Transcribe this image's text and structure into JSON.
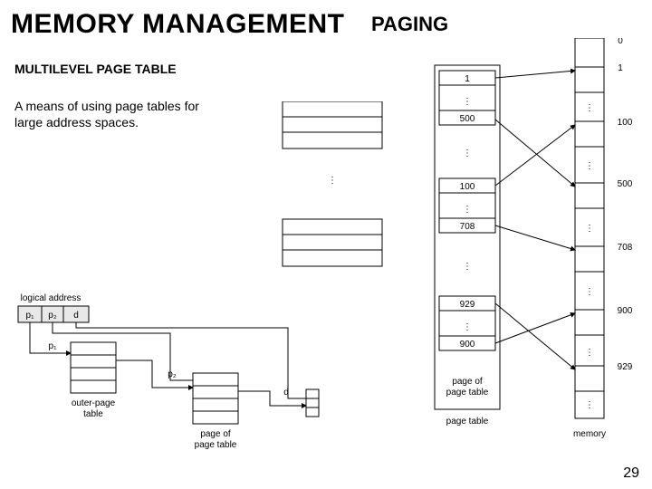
{
  "title_left": "MEMORY MANAGEMENT",
  "title_right": "PAGING",
  "subtitle": "MULTILEVEL PAGE TABLE",
  "body": "A means of using page tables for large address spaces.",
  "page_num": "29",
  "logical_address": {
    "label": "logical address",
    "parts": [
      "p₁",
      "p₂",
      "d"
    ]
  },
  "left_diagram": {
    "outer_label": "outer-page\ntable",
    "page_of_label": "page of\npage table",
    "p1": "p₁",
    "p2": "p₂",
    "d": "d"
  },
  "page_table": {
    "label": "page table",
    "page_of_label": "page of\npage table",
    "entries_top": [
      "1",
      "500"
    ],
    "entries_mid": [
      "100",
      "708"
    ],
    "entries_bot": [
      "929",
      "900"
    ]
  },
  "memory": {
    "label": "memory",
    "ticks": [
      "0",
      "1",
      "100",
      "500",
      "708",
      "900",
      "929"
    ]
  }
}
